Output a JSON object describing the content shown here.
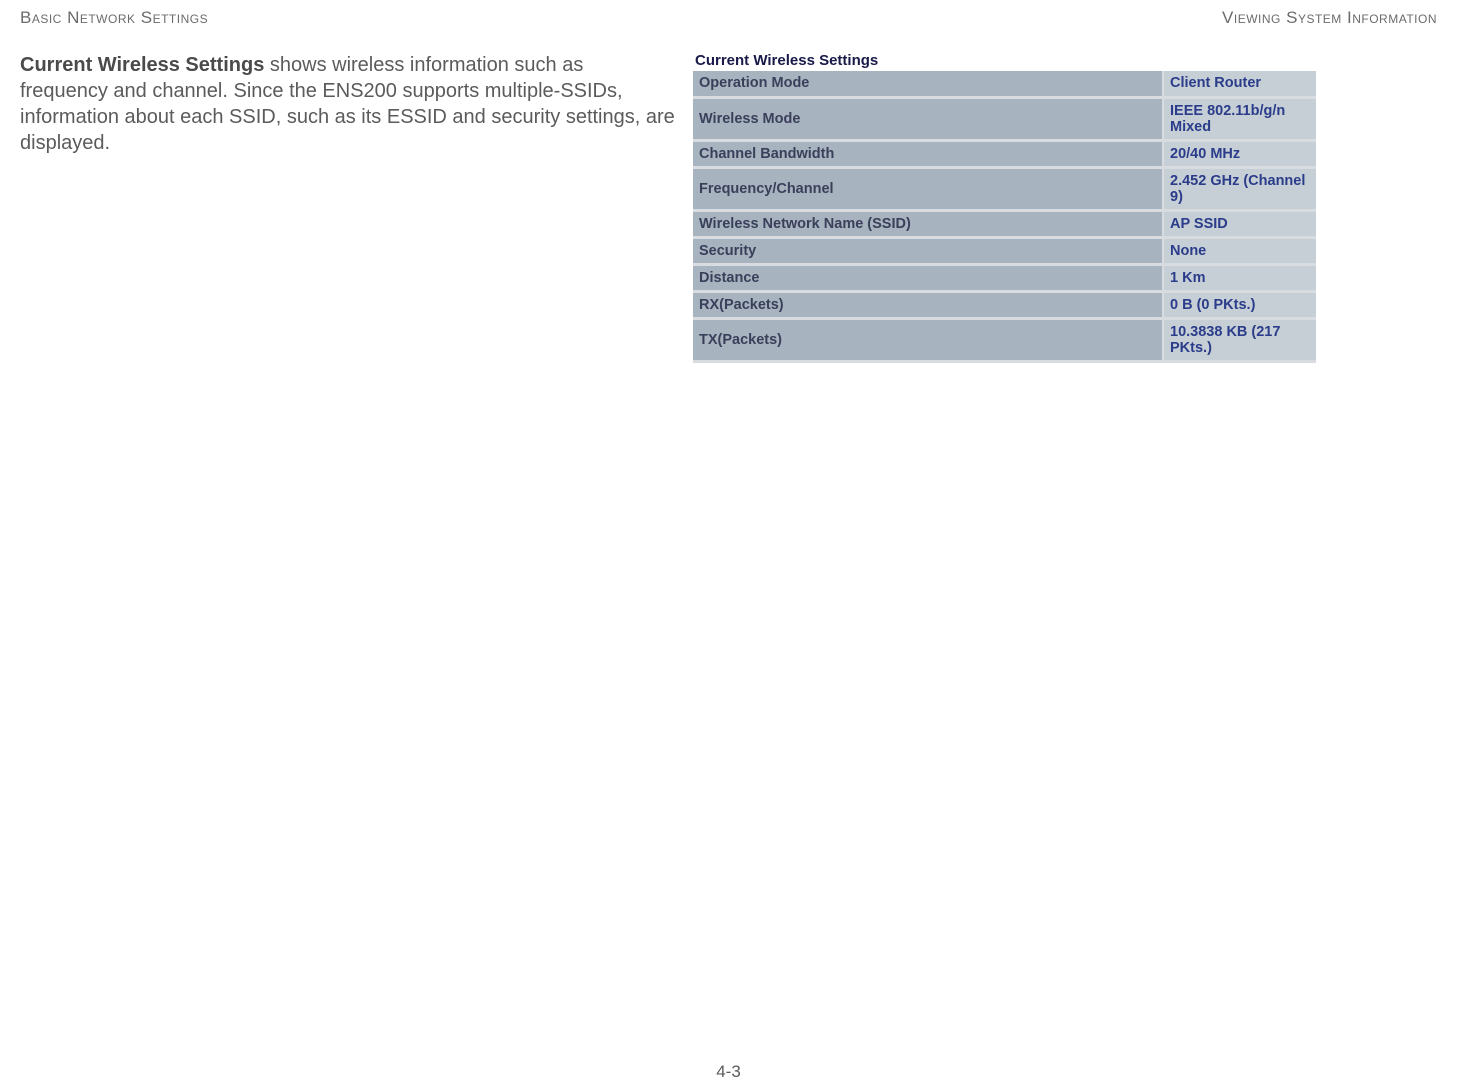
{
  "header": {
    "left": "Basic Network Settings",
    "right": "Viewing System Information"
  },
  "description": {
    "bold": "Current Wireless Settings",
    "rest": "  shows wireless information such as frequency and channel. Since the ENS200 supports multiple-SSIDs, information about each SSID, such as its ESSID and security settings, are displayed."
  },
  "table": {
    "title": "Current Wireless Settings",
    "rows": [
      {
        "label": "Operation Mode",
        "value": "Client Router"
      },
      {
        "label": "Wireless Mode",
        "value": "IEEE 802.11b/g/n Mixed"
      },
      {
        "label": "Channel Bandwidth",
        "value": "20/40 MHz"
      },
      {
        "label": "Frequency/Channel",
        "value": "2.452 GHz (Channel 9)"
      },
      {
        "label": "Wireless Network Name (SSID)",
        "value": "AP SSID"
      },
      {
        "label": "Security",
        "value": "None"
      },
      {
        "label": "Distance",
        "value": "1 Km"
      },
      {
        "label": "RX(Packets)",
        "value": "0 B (0 PKts.)"
      },
      {
        "label": "TX(Packets)",
        "value": "10.3838 KB (217 PKts.)"
      }
    ]
  },
  "page_number": "4-3"
}
